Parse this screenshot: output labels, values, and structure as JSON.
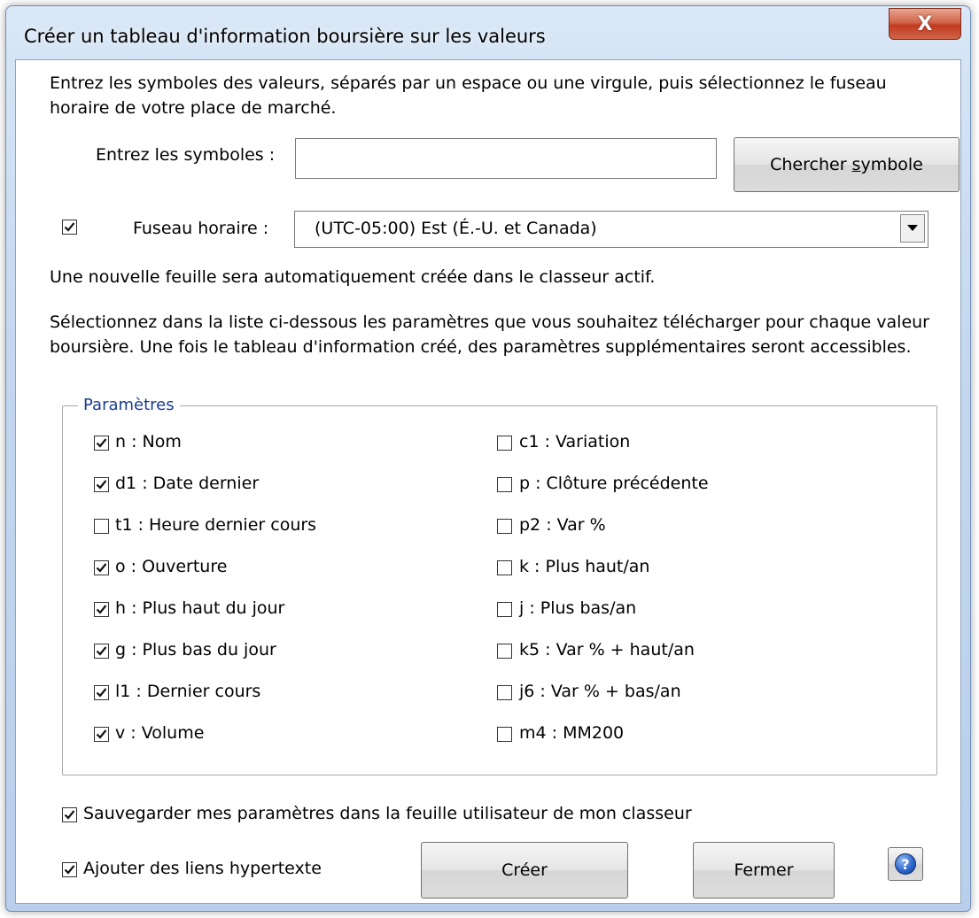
{
  "window": {
    "title": "Créer un tableau d'information boursière sur les valeurs",
    "close_label": "X"
  },
  "intro": {
    "line1": "Entrez les symboles  des valeurs, séparés par un espace ou une virgule, puis sélectionnez le fuseau",
    "line2": "horaire de votre place de marché."
  },
  "symbols": {
    "label": "Entrez les symboles :",
    "value": "",
    "search_button_prefix": "Chercher ",
    "search_button_underlined": "s",
    "search_button_suffix": "ymbole"
  },
  "timezone": {
    "checked": true,
    "label": "Fuseau horaire :",
    "selected": "(UTC-05:00) Est (É.-U. et Canada)"
  },
  "notice": "Une nouvelle feuille sera automatiquement créée dans le classeur actif.",
  "instructions": {
    "line1": "Sélectionnez dans la liste ci-dessous les paramètres que vous souhaitez télécharger pour chaque valeur",
    "line2": "boursière. Une fois le tableau d'information créé, des paramètres supplémentaires seront accessibles."
  },
  "params": {
    "legend": "Paramètres",
    "left": [
      {
        "label": "n  : Nom",
        "checked": true
      },
      {
        "label": "d1 : Date dernier",
        "checked": true
      },
      {
        "label": "t1 : Heure dernier cours",
        "checked": false
      },
      {
        "label": "o  : Ouverture",
        "checked": true
      },
      {
        "label": "h  : Plus haut du jour",
        "checked": true
      },
      {
        "label": "g  : Plus bas du jour",
        "checked": true
      },
      {
        "label": "l1 : Dernier cours",
        "checked": true
      },
      {
        "label": "v  : Volume",
        "checked": true
      }
    ],
    "right": [
      {
        "label": "c1 : Variation",
        "checked": false
      },
      {
        "label": "p  : Clôture précédente",
        "checked": false
      },
      {
        "label": "p2 : Var %",
        "checked": false
      },
      {
        "label": "k  : Plus haut/an",
        "checked": false
      },
      {
        "label": "j  : Plus bas/an",
        "checked": false
      },
      {
        "label": "k5 : Var % + haut/an",
        "checked": false
      },
      {
        "label": "j6 : Var % + bas/an",
        "checked": false
      },
      {
        "label": "m4 : MM200",
        "checked": false
      }
    ]
  },
  "save_settings": {
    "label": "Sauvegarder mes paramètres dans la feuille utilisateur de mon classeur",
    "checked": true
  },
  "hyperlinks": {
    "label": "Ajouter des liens hypertexte",
    "checked": true
  },
  "buttons": {
    "create": "Créer",
    "close": "Fermer",
    "help_icon": "help-icon"
  }
}
